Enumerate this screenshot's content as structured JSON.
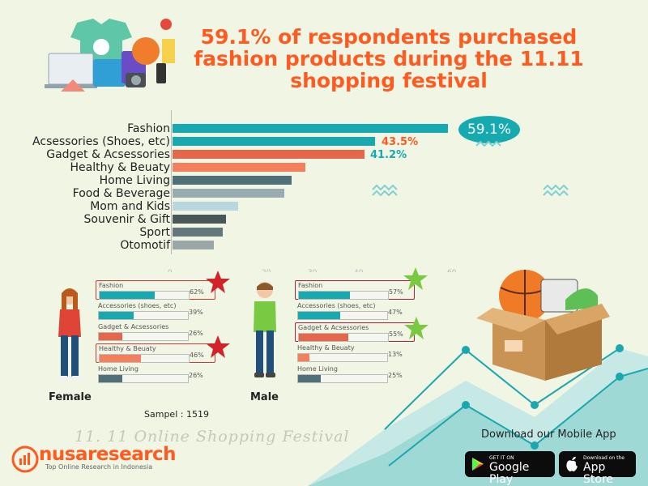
{
  "title": "59.1% of respondents purchased fashion products during the 11.11 shopping festival",
  "categories": [
    {
      "label": "Fashion",
      "value": 59.1,
      "color": "#17a9af"
    },
    {
      "label": "Acsessories (Shoes, etc)",
      "value": 43.5,
      "color": "#17a9af"
    },
    {
      "label": "Gadget & Acsessories",
      "value": 41.2,
      "color": "#e5674b"
    },
    {
      "label": "Healthy & Beuaty",
      "value": 28.5,
      "color": "#f47f5d"
    },
    {
      "label": "Home Living",
      "value": 25.5,
      "color": "#4f7076"
    },
    {
      "label": "Food & Beverage",
      "value": 24.0,
      "color": "#97abb0"
    },
    {
      "label": "Mom and Kids",
      "value": 14.0,
      "color": "#b9d7df"
    },
    {
      "label": "Souvenir & Gift",
      "value": 11.5,
      "color": "#4a5759"
    },
    {
      "label": "Sport",
      "value": 10.8,
      "color": "#63787c"
    },
    {
      "label": "Otomotif",
      "value": 8.8,
      "color": "#9aa7a8"
    }
  ],
  "callouts": {
    "fashion": "59.1%",
    "accessories": "43.5%",
    "gadget": "41.2%"
  },
  "axis_ticks": [
    "0",
    "20",
    "30",
    "40",
    "60"
  ],
  "female": {
    "label": "Female",
    "items": [
      {
        "label": "Fashion",
        "value": 62,
        "pct": "62%",
        "color": "#17a9af",
        "highlight": true
      },
      {
        "label": "Accessories (shoes, etc)",
        "value": 39,
        "pct": "39%",
        "color": "#17a9af",
        "highlight": false
      },
      {
        "label": "Gadget & Acsessories",
        "value": 26,
        "pct": "26%",
        "color": "#e5674b",
        "highlight": false
      },
      {
        "label": "Healthy & Beuaty",
        "value": 46,
        "pct": "46%",
        "color": "#f47f5d",
        "highlight": true
      },
      {
        "label": "Home Living",
        "value": 26,
        "pct": "26%",
        "color": "#4f7076",
        "highlight": false
      }
    ]
  },
  "male": {
    "label": "Male",
    "items": [
      {
        "label": "Fashion",
        "value": 57,
        "pct": "57%",
        "color": "#17a9af",
        "highlight": true
      },
      {
        "label": "Accessories (shoes, etc)",
        "value": 47,
        "pct": "47%",
        "color": "#17a9af",
        "highlight": false
      },
      {
        "label": "Gadget & Acsessories",
        "value": 55,
        "pct": "55%",
        "color": "#e5674b",
        "highlight": true
      },
      {
        "label": "Healthy & Beuaty",
        "value": 13,
        "pct": "13%",
        "color": "#f47f5d",
        "highlight": false
      },
      {
        "label": "Home Living",
        "value": 25,
        "pct": "25%",
        "color": "#4f7076",
        "highlight": false
      }
    ]
  },
  "sample": "Sampel : 1519",
  "festival": "11. 11 Online Shopping Festival",
  "logo": {
    "name": "nusaresearch",
    "tagline": "Top Online Research in Indonesia"
  },
  "app": {
    "title": "Download our Mobile App",
    "google_small": "GET IT ON",
    "google_big": "Google Play",
    "apple_small": "Download on the",
    "apple_big": "App Store"
  },
  "colors": {
    "accent": "#ff5a1f",
    "teal": "#15aab0",
    "red_star": "#d1232a",
    "green_star": "#7ac943"
  }
}
